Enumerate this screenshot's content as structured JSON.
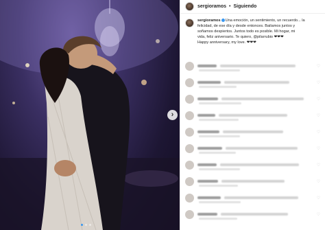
{
  "post": {
    "username": "sergioramos",
    "separator": "•",
    "follow_status": "Siguiendo",
    "caption_lines": [
      "Una emoción, un sentimiento, un recuerdo... la",
      "felicidad, de ese día y desde entonces. Bailamos juntos y",
      "soñamos despiertos. Juntos todo es posible. Mi hogar, mi",
      "vida, feliz aniversario. Te quiero, @pilarrubio ❤❤❤",
      "Happy anniversary, my love. ❤❤❤"
    ]
  },
  "photo": {
    "next_chevron": "›",
    "carousel_position": 1,
    "carousel_count": 3
  },
  "comments": {
    "count_visible": 10,
    "heart_glyph": "♡"
  },
  "colors": {
    "accent": "#3897f0",
    "heart": "#ed4956",
    "text": "#262626"
  },
  "icons": [
    "verified-badge-icon",
    "chevron-right-icon",
    "heart-icon"
  ]
}
